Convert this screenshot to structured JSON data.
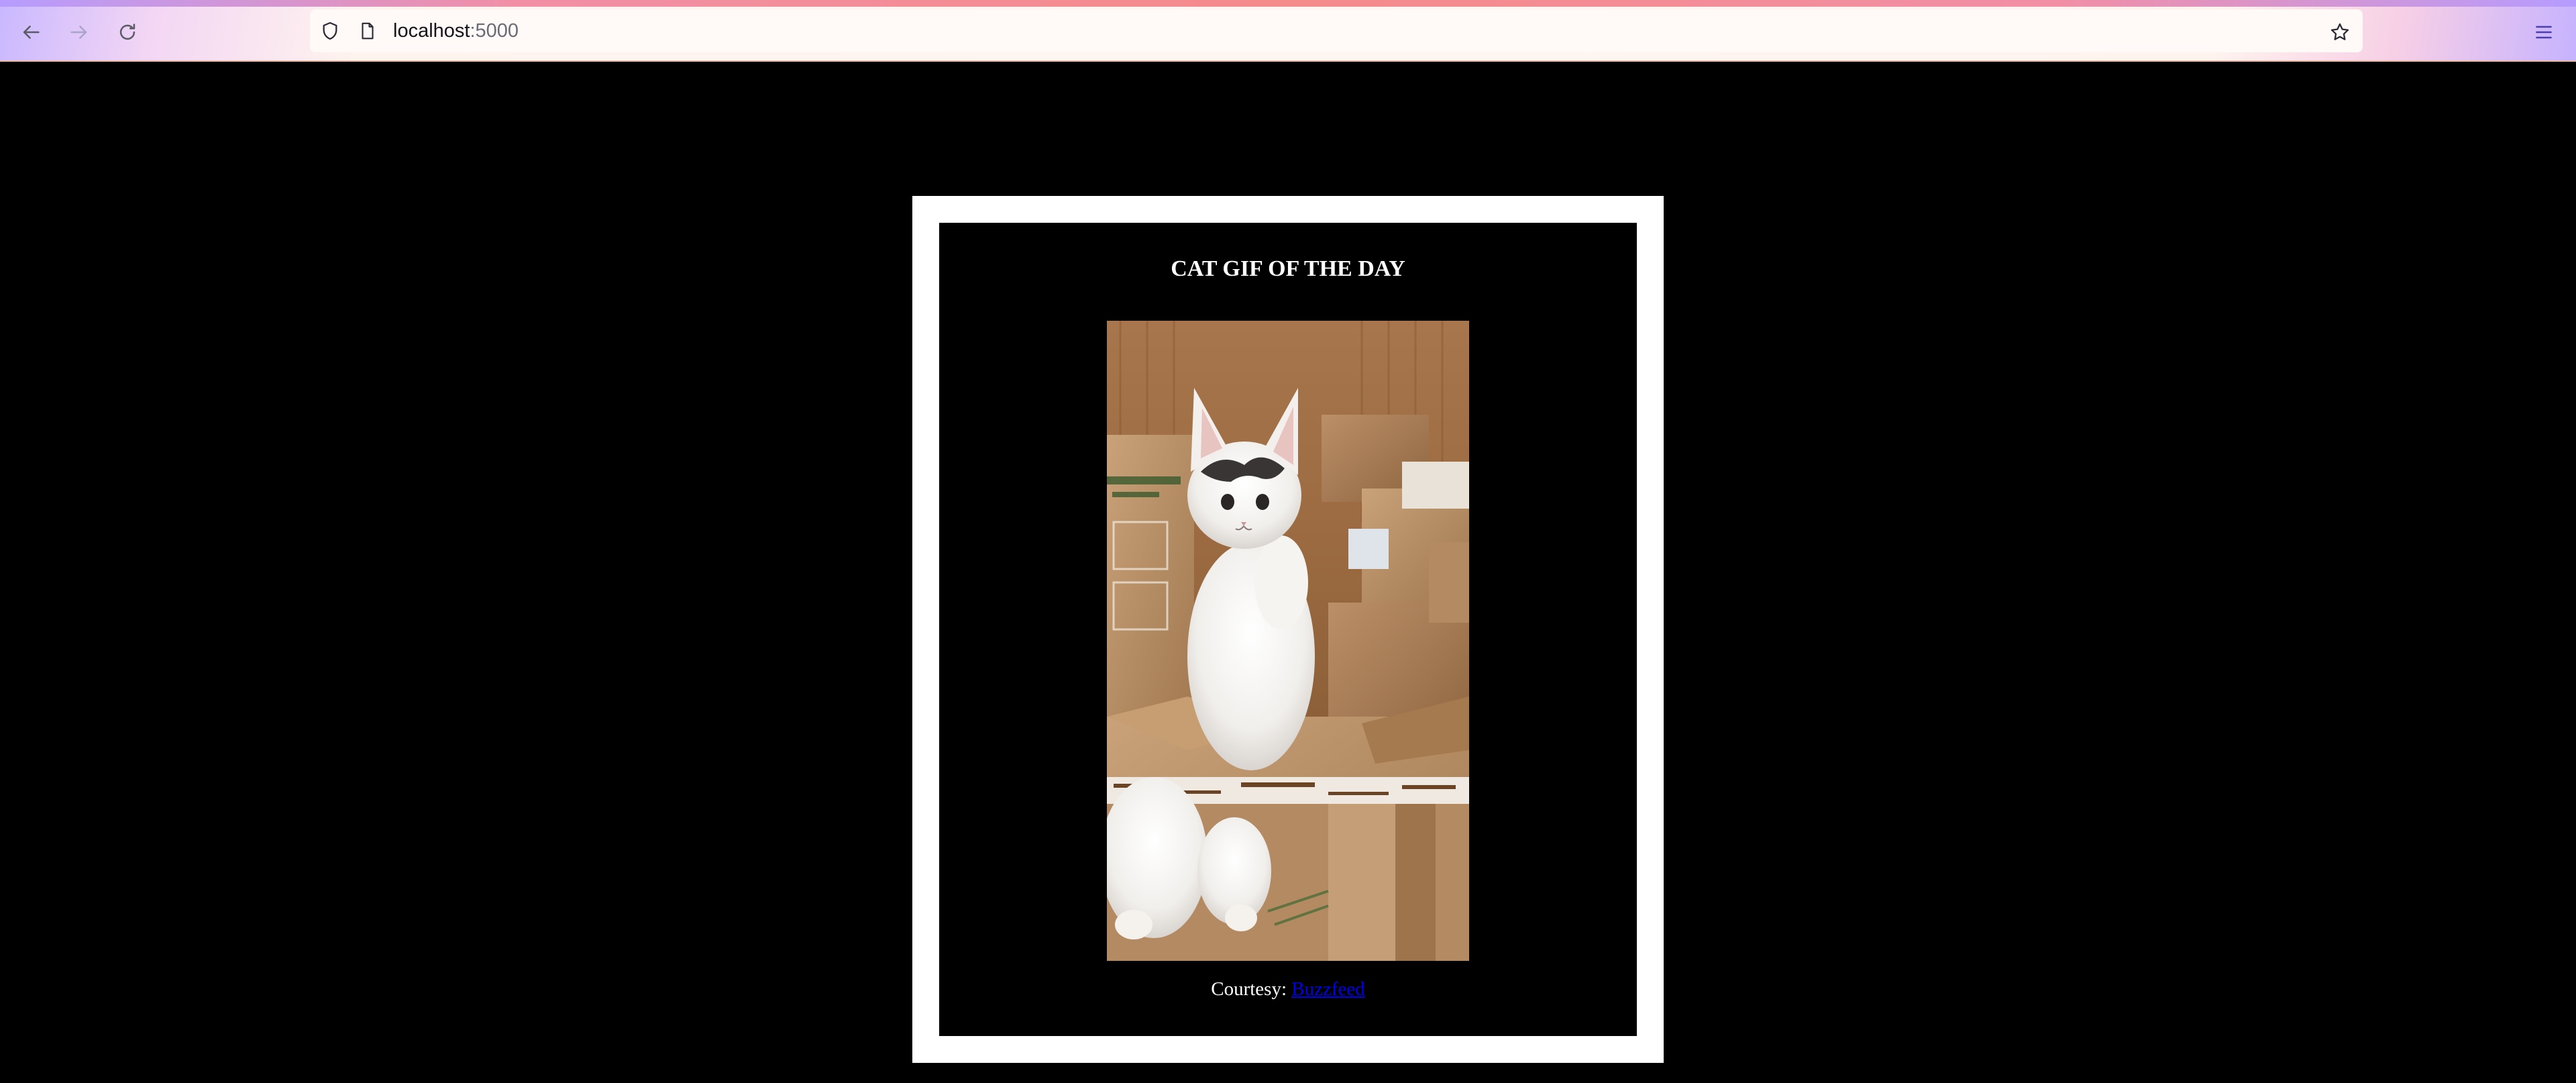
{
  "browser": {
    "url_host": "localhost",
    "url_port": ":5000",
    "icons": {
      "back": "arrow-left-icon",
      "forward": "arrow-right-icon",
      "reload": "reload-icon",
      "tracking": "shield-icon",
      "page": "page-icon",
      "bookmark": "star-icon",
      "menu": "hamburger-menu-icon"
    }
  },
  "page": {
    "title": "CAT GIF OF THE DAY",
    "image_alt": "cat-gif",
    "courtesy_label": "Courtesy:",
    "courtesy_link": "Buzzfeed"
  },
  "colors": {
    "page_background": "#000000",
    "frame": "#ffffff",
    "link": "#0000ee"
  }
}
